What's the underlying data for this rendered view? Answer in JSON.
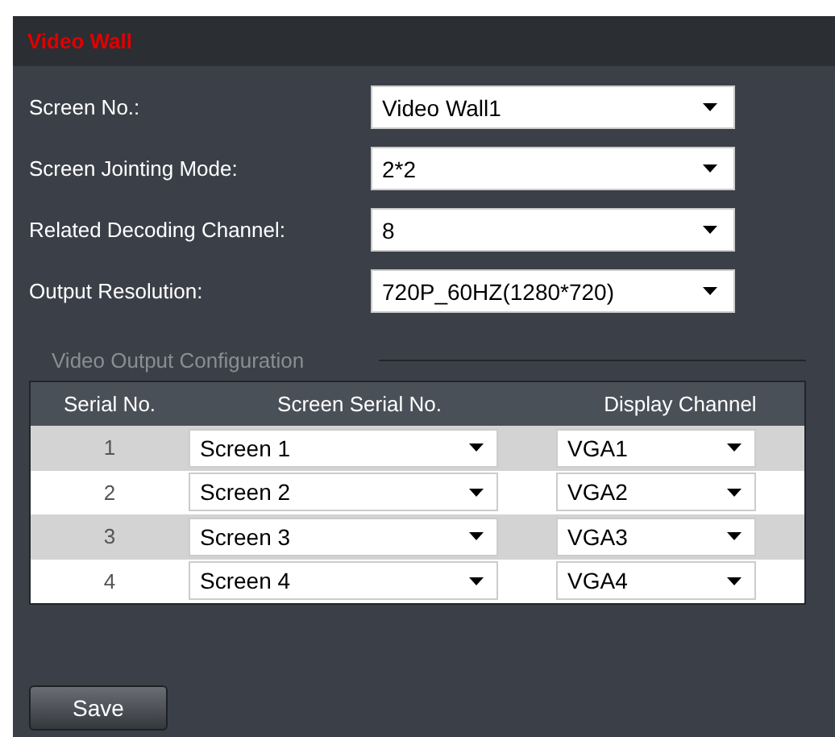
{
  "panel": {
    "title": "Video Wall"
  },
  "fields": [
    {
      "label": "Screen No.:",
      "value": "Video Wall1"
    },
    {
      "label": "Screen Jointing Mode:",
      "value": "2*2"
    },
    {
      "label": "Related Decoding Channel:",
      "value": "8"
    },
    {
      "label": "Output Resolution:",
      "value": "720P_60HZ(1280*720)"
    }
  ],
  "section": {
    "title": "Video Output Configuration"
  },
  "table": {
    "columns": [
      "Serial No.",
      "Screen Serial No.",
      "Display Channel"
    ],
    "rows": [
      {
        "serial": "1",
        "screen": "Screen 1",
        "channel": "VGA1"
      },
      {
        "serial": "2",
        "screen": "Screen 2",
        "channel": "VGA2"
      },
      {
        "serial": "3",
        "screen": "Screen 3",
        "channel": "VGA3"
      },
      {
        "serial": "4",
        "screen": "Screen 4",
        "channel": "VGA4"
      }
    ]
  },
  "buttons": [
    "Save"
  ]
}
